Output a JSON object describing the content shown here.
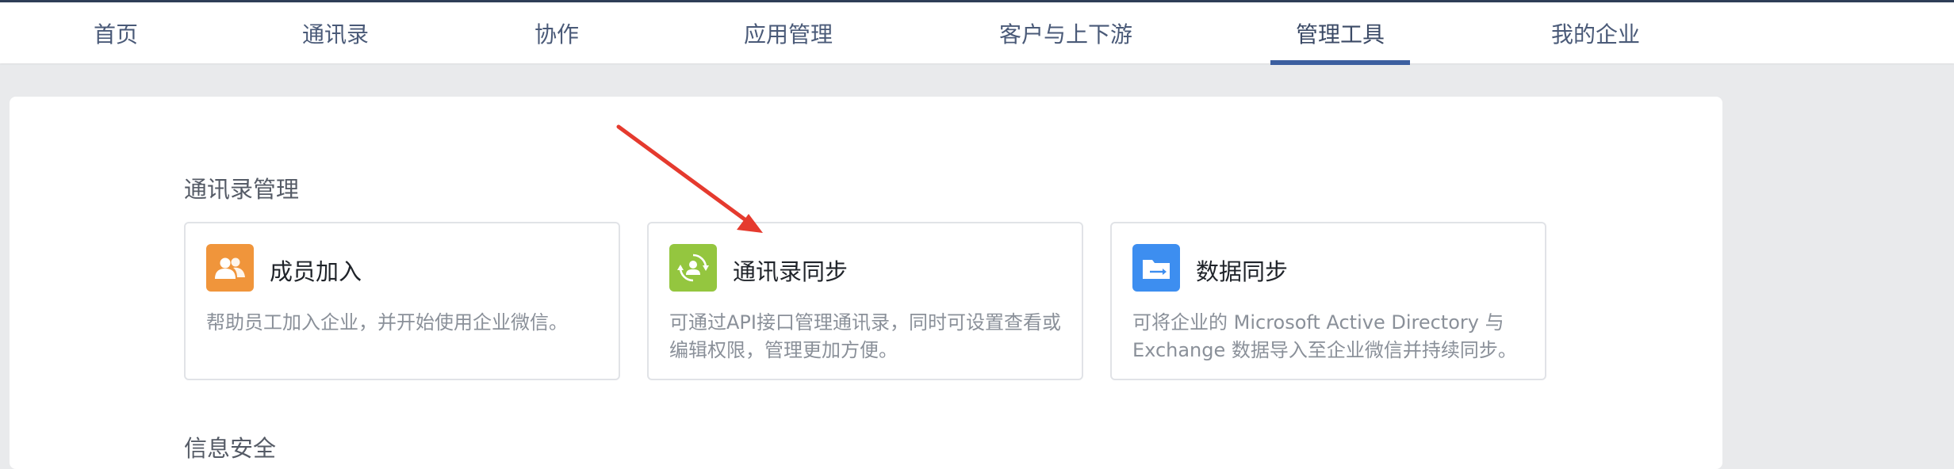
{
  "nav": {
    "tabs": [
      {
        "label": "首页"
      },
      {
        "label": "通讯录"
      },
      {
        "label": "协作"
      },
      {
        "label": "应用管理"
      },
      {
        "label": "客户与上下游"
      },
      {
        "label": "管理工具",
        "active": true
      },
      {
        "label": "我的企业"
      }
    ]
  },
  "main": {
    "section_contacts": "通讯录管理",
    "section_security": "信息安全",
    "cards": [
      {
        "icon": "members-icon",
        "color": "#f0953b",
        "title": "成员加入",
        "desc": "帮助员工加入企业，并开始使用企业微信。"
      },
      {
        "icon": "contact-sync-icon",
        "color": "#94c63f",
        "title": "通讯录同步",
        "desc": "可通过API接口管理通讯录，同时可设置查看或编辑权限，管理更加方便。"
      },
      {
        "icon": "folder-sync-icon",
        "color": "#3d8ef0",
        "title": "数据同步",
        "desc": "可将企业的 Microsoft Active Directory 与 Exchange 数据导入至企业微信并持续同步。"
      }
    ]
  },
  "annotation": {
    "arrow_color": "#e53a2e"
  }
}
